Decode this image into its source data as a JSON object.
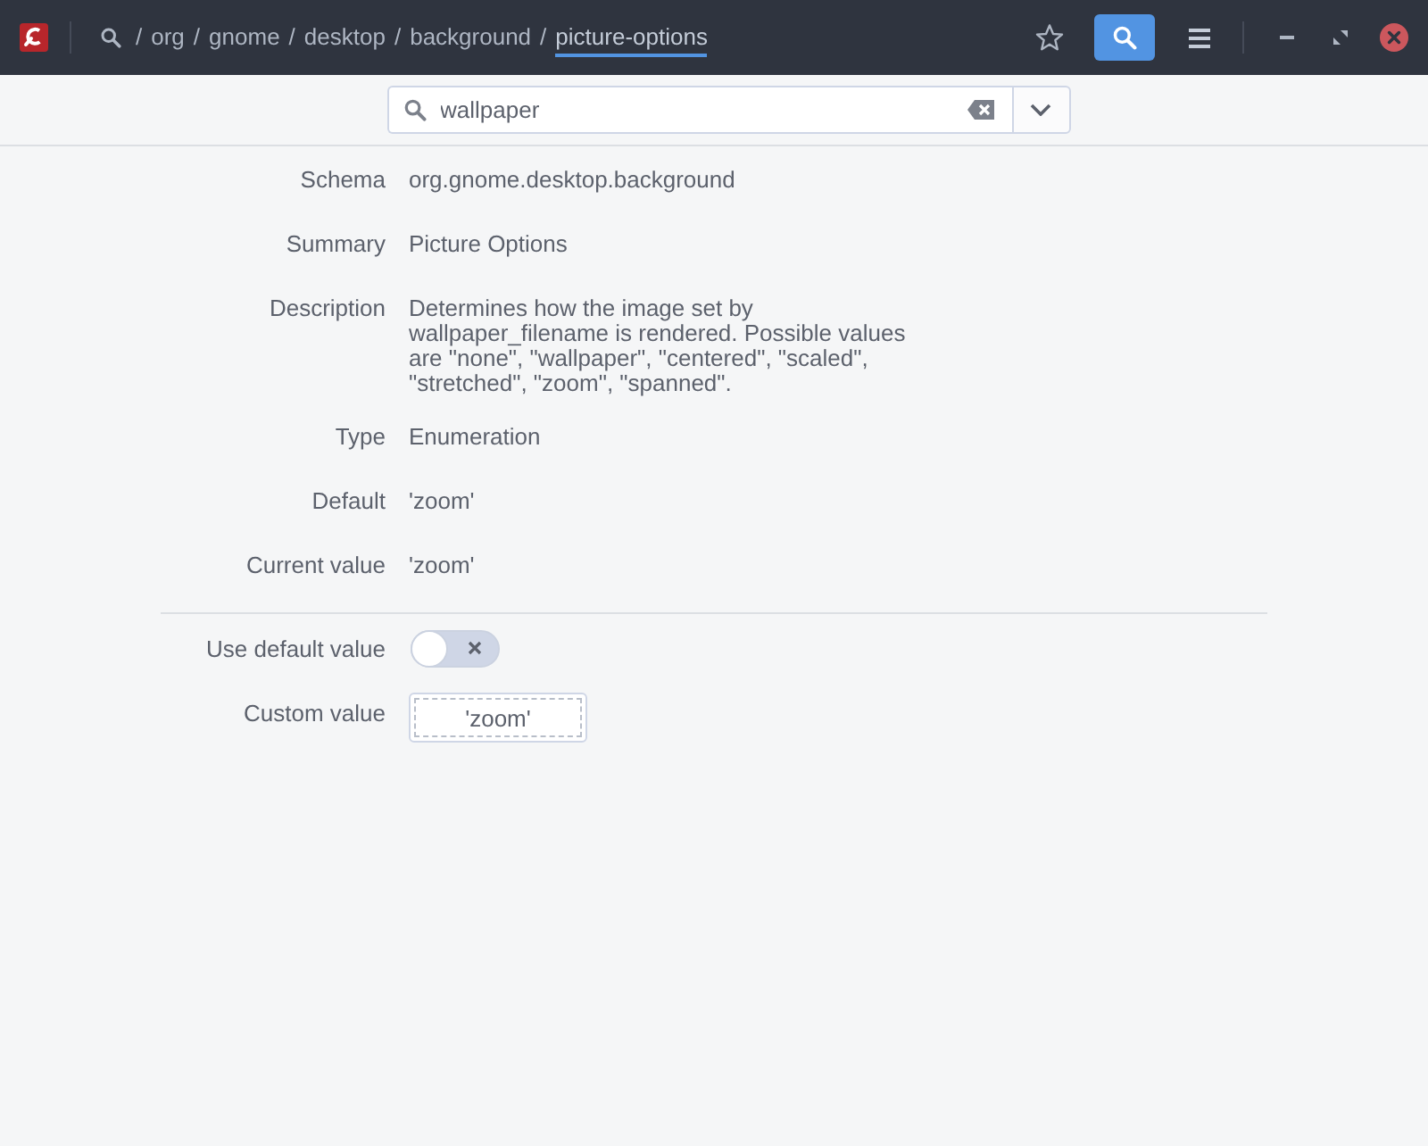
{
  "header": {
    "path": [
      {
        "separator": "/",
        "label": "org",
        "selected": false
      },
      {
        "separator": "/",
        "label": "gnome",
        "selected": false
      },
      {
        "separator": "/",
        "label": "desktop",
        "selected": false
      },
      {
        "separator": "/",
        "label": "background",
        "selected": false
      },
      {
        "separator": "/",
        "label": "picture-options",
        "selected": true
      }
    ],
    "search_button": {
      "active": true
    }
  },
  "search": {
    "value": "wallpaper"
  },
  "properties": [
    {
      "label": "Schema",
      "value": "org.gnome.desktop.background"
    },
    {
      "label": "Summary",
      "value": "Picture Options"
    },
    {
      "label": "Description",
      "value": "Determines how the image set by\nwallpaper_filename is rendered. Possible values\nare \"none\", \"wallpaper\", \"centered\", \"scaled\",\n\"stretched\", \"zoom\", \"spanned\"."
    },
    {
      "label": "Type",
      "value": "Enumeration"
    },
    {
      "label": "Default",
      "value": "'zoom'"
    },
    {
      "label": "Current value",
      "value": "'zoom'"
    }
  ],
  "use_default_value": {
    "label": "Use default value",
    "on": false
  },
  "custom_value": {
    "label": "Custom value",
    "value": "'zoom'"
  }
}
